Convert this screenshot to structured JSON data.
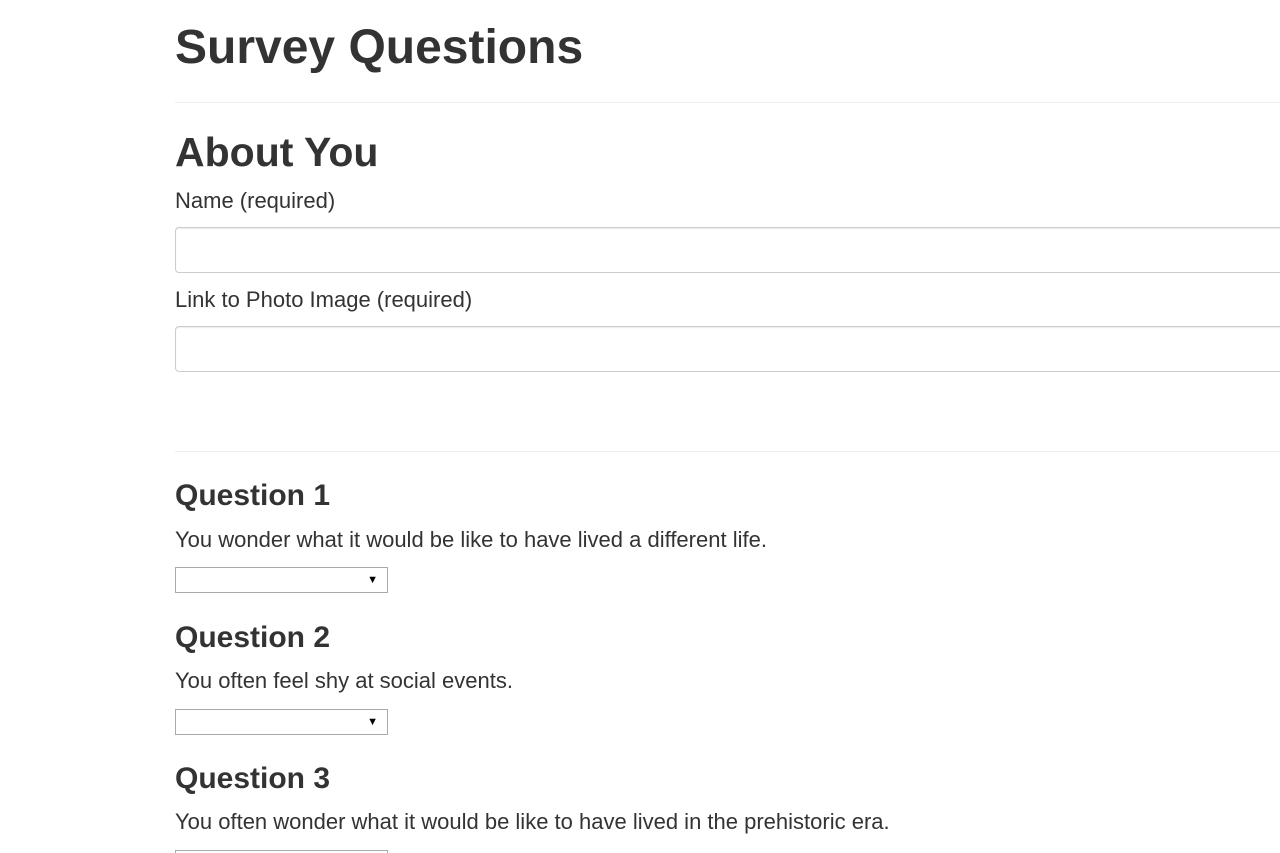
{
  "page": {
    "title": "Survey Questions"
  },
  "about": {
    "section_title": "About You",
    "name_label": "Name (required)",
    "name_value": "",
    "photo_label": "Link to Photo Image (required)",
    "photo_value": ""
  },
  "questions": [
    {
      "title": "Question 1",
      "text": "You wonder what it would be like to have lived a different life.",
      "selected": ""
    },
    {
      "title": "Question 2",
      "text": "You often feel shy at social events.",
      "selected": ""
    },
    {
      "title": "Question 3",
      "text": "You often wonder what it would be like to have lived in the prehistoric era.",
      "selected": ""
    }
  ],
  "icons": {
    "select_arrow": "caret-down-icon"
  }
}
